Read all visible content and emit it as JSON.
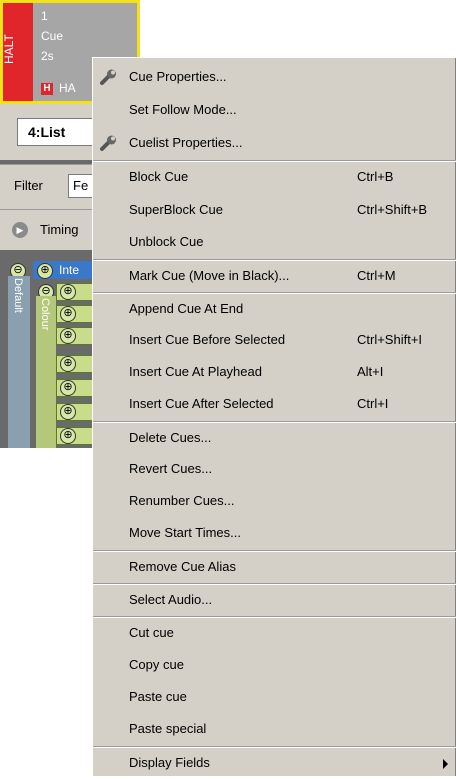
{
  "app": {
    "cue_tile": {
      "halt_vertical": "HALT",
      "number": "1",
      "name": "Cue",
      "time": "2s",
      "halt_badge": "H",
      "halt_label": "HA",
      "colors": {
        "frame": "#f5e11a",
        "halt": "#e0262b",
        "body": "#a6a6a6"
      }
    },
    "list_select": {
      "value": "4:List"
    },
    "filter": {
      "label": "Filter",
      "value": "Fe"
    },
    "timing": {
      "label": "Timing"
    },
    "tree": {
      "intel_label": "Inte",
      "default_label": "Default",
      "colour_label": "Colour",
      "collapse_symbol": "⊖",
      "expand_symbol": "⊕"
    }
  },
  "context_menu": {
    "items": [
      {
        "label": "Cue Properties...",
        "shortcut": "",
        "icon": "wrench-icon"
      },
      {
        "label": "Set Follow Mode...",
        "shortcut": "",
        "icon": ""
      },
      {
        "label": "Cuelist Properties...",
        "shortcut": "",
        "icon": "wrench-icon"
      },
      {
        "label": "Block Cue",
        "shortcut": "Ctrl+B",
        "icon": ""
      },
      {
        "label": "SuperBlock Cue",
        "shortcut": "Ctrl+Shift+B",
        "icon": ""
      },
      {
        "label": "Unblock Cue",
        "shortcut": "",
        "icon": ""
      },
      {
        "label": "Mark Cue (Move in Black)...",
        "shortcut": "Ctrl+M",
        "icon": ""
      },
      {
        "label": "Append Cue At End",
        "shortcut": "",
        "icon": ""
      },
      {
        "label": "Insert Cue Before Selected",
        "shortcut": "Ctrl+Shift+I",
        "icon": ""
      },
      {
        "label": "Insert Cue At Playhead",
        "shortcut": "Alt+I",
        "icon": ""
      },
      {
        "label": "Insert Cue After Selected",
        "shortcut": "Ctrl+I",
        "icon": ""
      },
      {
        "label": "Delete Cues...",
        "shortcut": "",
        "icon": ""
      },
      {
        "label": "Revert Cues...",
        "shortcut": "",
        "icon": ""
      },
      {
        "label": "Renumber Cues...",
        "shortcut": "",
        "icon": ""
      },
      {
        "label": "Move Start Times...",
        "shortcut": "",
        "icon": ""
      },
      {
        "label": "Remove Cue Alias",
        "shortcut": "",
        "icon": ""
      },
      {
        "label": "Select Audio...",
        "shortcut": "",
        "icon": ""
      },
      {
        "label": "Cut cue",
        "shortcut": "",
        "icon": ""
      },
      {
        "label": "Copy cue",
        "shortcut": "",
        "icon": ""
      },
      {
        "label": "Paste cue",
        "shortcut": "",
        "icon": ""
      },
      {
        "label": "Paste special",
        "shortcut": "",
        "icon": ""
      },
      {
        "label": "Display Fields",
        "shortcut": "",
        "icon": "submenu-arrow-icon"
      }
    ],
    "colors": {
      "background": "#d4d0c8"
    }
  }
}
